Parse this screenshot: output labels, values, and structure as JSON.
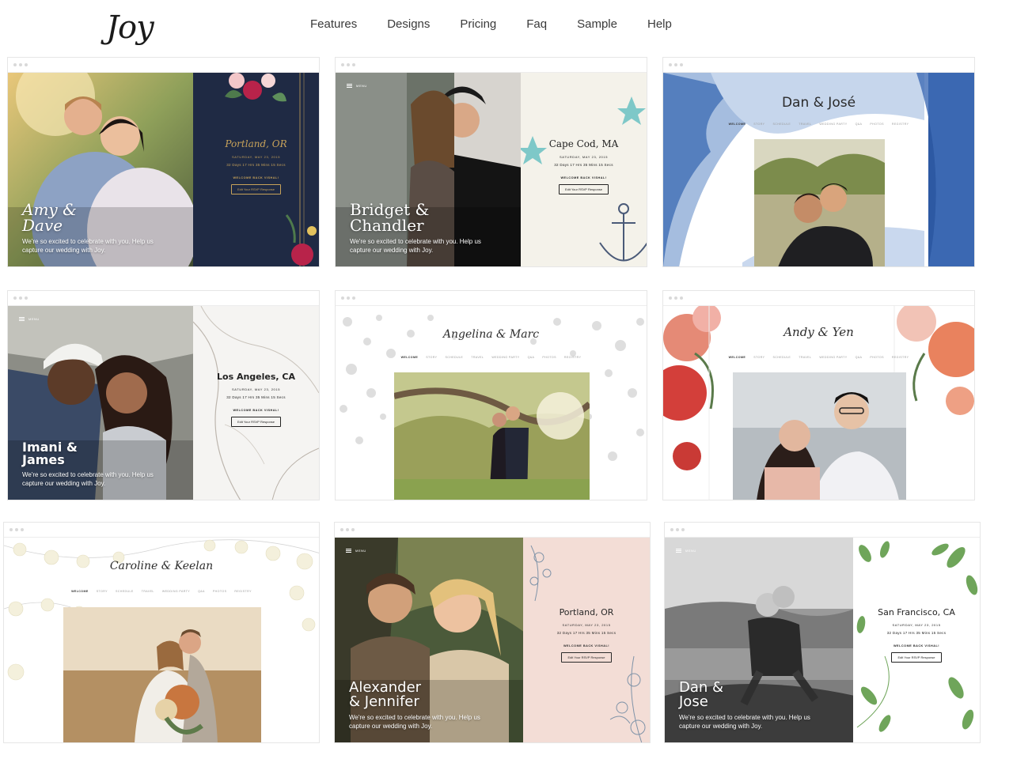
{
  "header": {
    "logo": "Joy",
    "nav": [
      "Features",
      "Designs",
      "Pricing",
      "Faq",
      "Sample",
      "Help"
    ]
  },
  "common": {
    "tagline": "We're so excited to celebrate with you. Help us capture our wedding with Joy.",
    "date": "SATURDAY, MAY 23, 2015",
    "countdown": "32 Days   17 Hrs   35 Mins   15 Secs",
    "welcome": "WELCOME BACK VISHAL!",
    "rsvp": "Edit Your RSVP Response",
    "menu": "MENU",
    "site_nav": [
      "WELCOME",
      "STORY",
      "SCHEDULE",
      "TRAVEL",
      "WEDDING PARTY",
      "Q&A",
      "PHOTOS",
      "REGISTRY"
    ]
  },
  "designs": [
    {
      "names_line1": "Amy &",
      "names_line2": "Dave",
      "city": "Portland, OR"
    },
    {
      "names_line1": "Bridget &",
      "names_line2": "Chandler",
      "city": "Cape Cod, MA"
    },
    {
      "names": "Dan & José"
    },
    {
      "names_line1": "Imani &",
      "names_line2": "James",
      "city": "Los Angeles, CA"
    },
    {
      "names": "Angelina & Marc"
    },
    {
      "names": "Andy & Yen"
    },
    {
      "names": "Caroline & Keelan"
    },
    {
      "names_line1": "Alexander",
      "names_line2": "& Jennifer",
      "city": "Portland, OR"
    },
    {
      "names_line1": "Dan &",
      "names_line2": "Jose",
      "city": "San Francisco, CA"
    }
  ],
  "colors": {
    "navy_panel": "#1f2a44",
    "gold": "#c7a25a",
    "cream_panel": "#f4f2ea",
    "blush_panel": "#f3ddd6",
    "watercolor_blue": "#2f5fa8"
  }
}
